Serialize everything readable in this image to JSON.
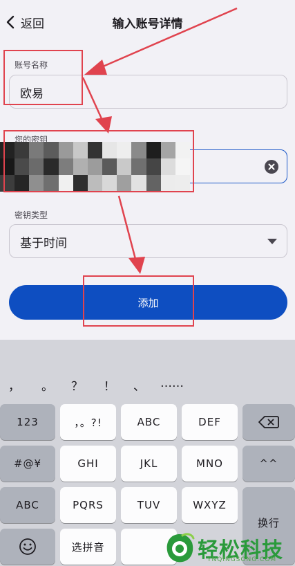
{
  "header": {
    "back_label": "返回",
    "title": "输入账号详情"
  },
  "form": {
    "account_name": {
      "label": "账号名称",
      "value": "欧易"
    },
    "secret_key": {
      "label": "您的密钥"
    },
    "key_type": {
      "label": "密钥类型",
      "value": "基于时间"
    },
    "add_label": "添加"
  },
  "keyboard": {
    "candidates": [
      "，",
      "。",
      "？",
      "！",
      "、",
      "……"
    ],
    "row1": [
      "123",
      "，。?!",
      "ABC",
      "DEF"
    ],
    "row2": [
      "#@¥",
      "GHI",
      "JKL",
      "MNO",
      "^^"
    ],
    "row3": [
      "ABC",
      "PQRS",
      "TUV",
      "WXYZ"
    ],
    "return_label": "换行",
    "pinyin_label": "选拼音"
  },
  "watermark": {
    "text": "轻松科技",
    "sub": "YNQINGSONG.COM"
  },
  "colors": {
    "primary": "#0e4ec1",
    "annotation": "#e0434e",
    "watermark": "#2a9a3b"
  }
}
